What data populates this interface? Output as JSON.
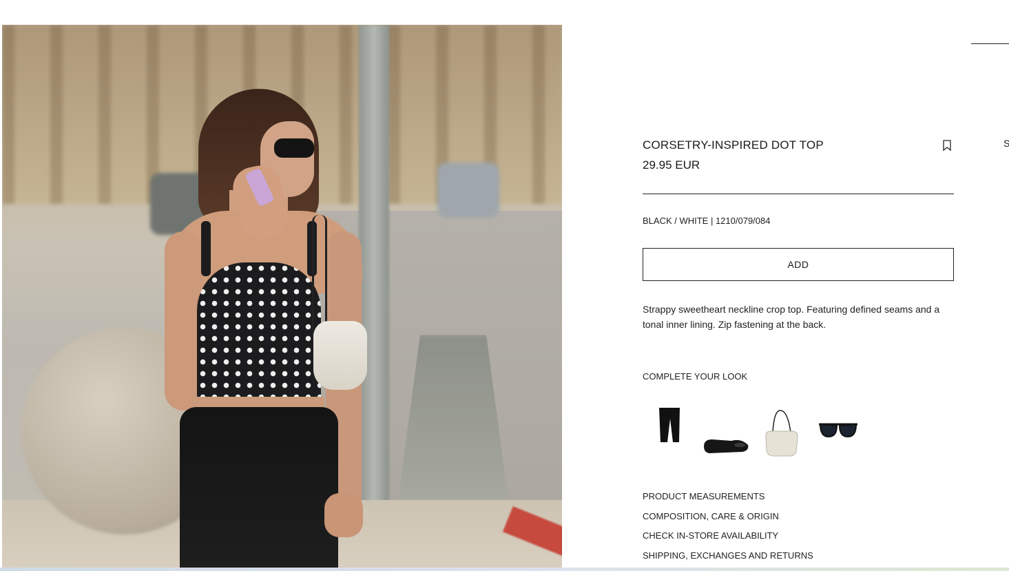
{
  "product": {
    "title": "CORSETRY-INSPIRED DOT TOP",
    "price": "29.95 EUR",
    "color_ref": "BLACK / WHITE | 1210/079/084",
    "add_label": "ADD",
    "description": "Strappy sweetheart neckline crop top. Featuring defined seams and a tonal inner lining. Zip fastening at the back."
  },
  "edge_text": "S",
  "complete_look": {
    "title": "COMPLETE YOUR LOOK",
    "items": [
      "black-trousers",
      "black-ballet-flats",
      "white-shoulder-bag",
      "black-sunglasses"
    ]
  },
  "info_links": [
    "PRODUCT MEASUREMENTS",
    "COMPOSITION, CARE & ORIGIN",
    "CHECK IN-STORE AVAILABILITY",
    "SHIPPING, EXCHANGES AND RETURNS"
  ],
  "icons": {
    "bookmark": "bookmark-icon"
  },
  "colors": {
    "text": "#1a1a1a",
    "background": "#ffffff",
    "border": "#222222"
  }
}
